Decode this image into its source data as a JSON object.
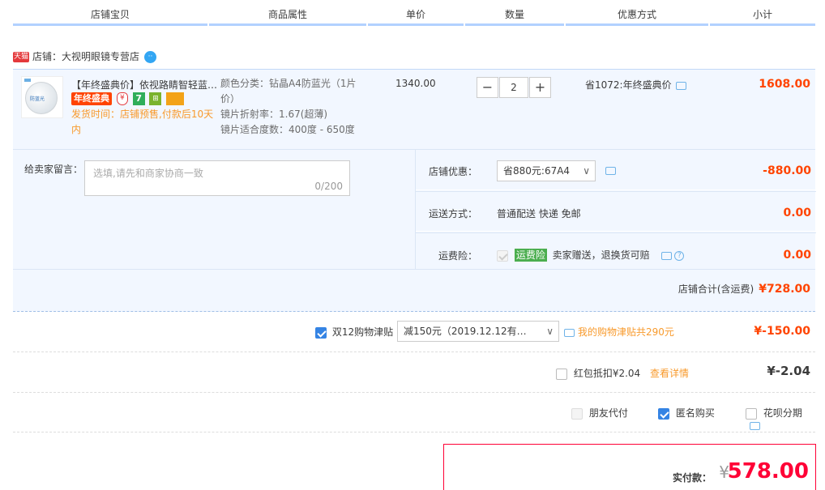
{
  "header": {
    "cols": [
      "店铺宝贝",
      "商品属性",
      "单价",
      "数量",
      "优惠方式",
      "小计"
    ]
  },
  "shop": {
    "badge": "天猫",
    "name": "店铺：大视明眼镜专营店",
    "chat_glyph": "··"
  },
  "item": {
    "thumb_text": "防蓝光",
    "title": "【年终盛典价】依视路睛智轻蓝光眼镜",
    "badges": {
      "year": "年终盛典",
      "shield": "¥",
      "seven": "7",
      "bag": "⊞"
    },
    "ship_note": "发货时间：店铺预售,付款后10天内",
    "props": [
      "颜色分类：钻晶A4防蓝光（1片价）",
      "镜片折射率：1.67(超薄)",
      "镜片适合度数：400度 - 650度"
    ],
    "price": "1340.00",
    "qty": {
      "minus": "−",
      "value": "2",
      "plus": "+"
    },
    "promo": "省1072:年终盛典价",
    "subtotal": "1608.00"
  },
  "leave_msg": {
    "label": "给卖家留言：",
    "placeholder": "选填,请先和商家协商一致",
    "count": "0/200"
  },
  "shop_discount": {
    "label": "店铺优惠：",
    "value": "省880元:67A4",
    "chevron": "∨",
    "amount": "-880.00"
  },
  "shipping": {
    "label": "运送方式：",
    "value": "普通配送 快递 免邮",
    "amount": "0.00"
  },
  "insurance": {
    "label": "运费险：",
    "tag": "运费险",
    "text": "卖家赠送，退换货可赔",
    "help": "?",
    "amount": "0.00"
  },
  "shop_total": {
    "label": "店铺合计(含运费)",
    "amount": "¥728.00"
  },
  "allowance": {
    "label": "双12购物津贴",
    "select": "减150元（2019.12.12有…",
    "chevron": "∨",
    "link": "我的购物津贴共290元",
    "amount": "¥-150.00"
  },
  "redpacket": {
    "label": "红包抵扣¥2.04",
    "link": "查看详情",
    "amount": "¥-2.04"
  },
  "options": {
    "friend": "朋友代付",
    "anonymous": "匿名购买",
    "huabei": "花呗分期"
  },
  "pay": {
    "label": "实付款：",
    "yen": "¥",
    "amount": "578.00"
  },
  "colors": {
    "accent": "#ff0036",
    "price_red": "#ff4400",
    "link_orange": "#f89a2c",
    "panel_bg": "#f2f7ff",
    "header_line": "#b2d1ff",
    "checkbox_blue": "#3584e4"
  }
}
